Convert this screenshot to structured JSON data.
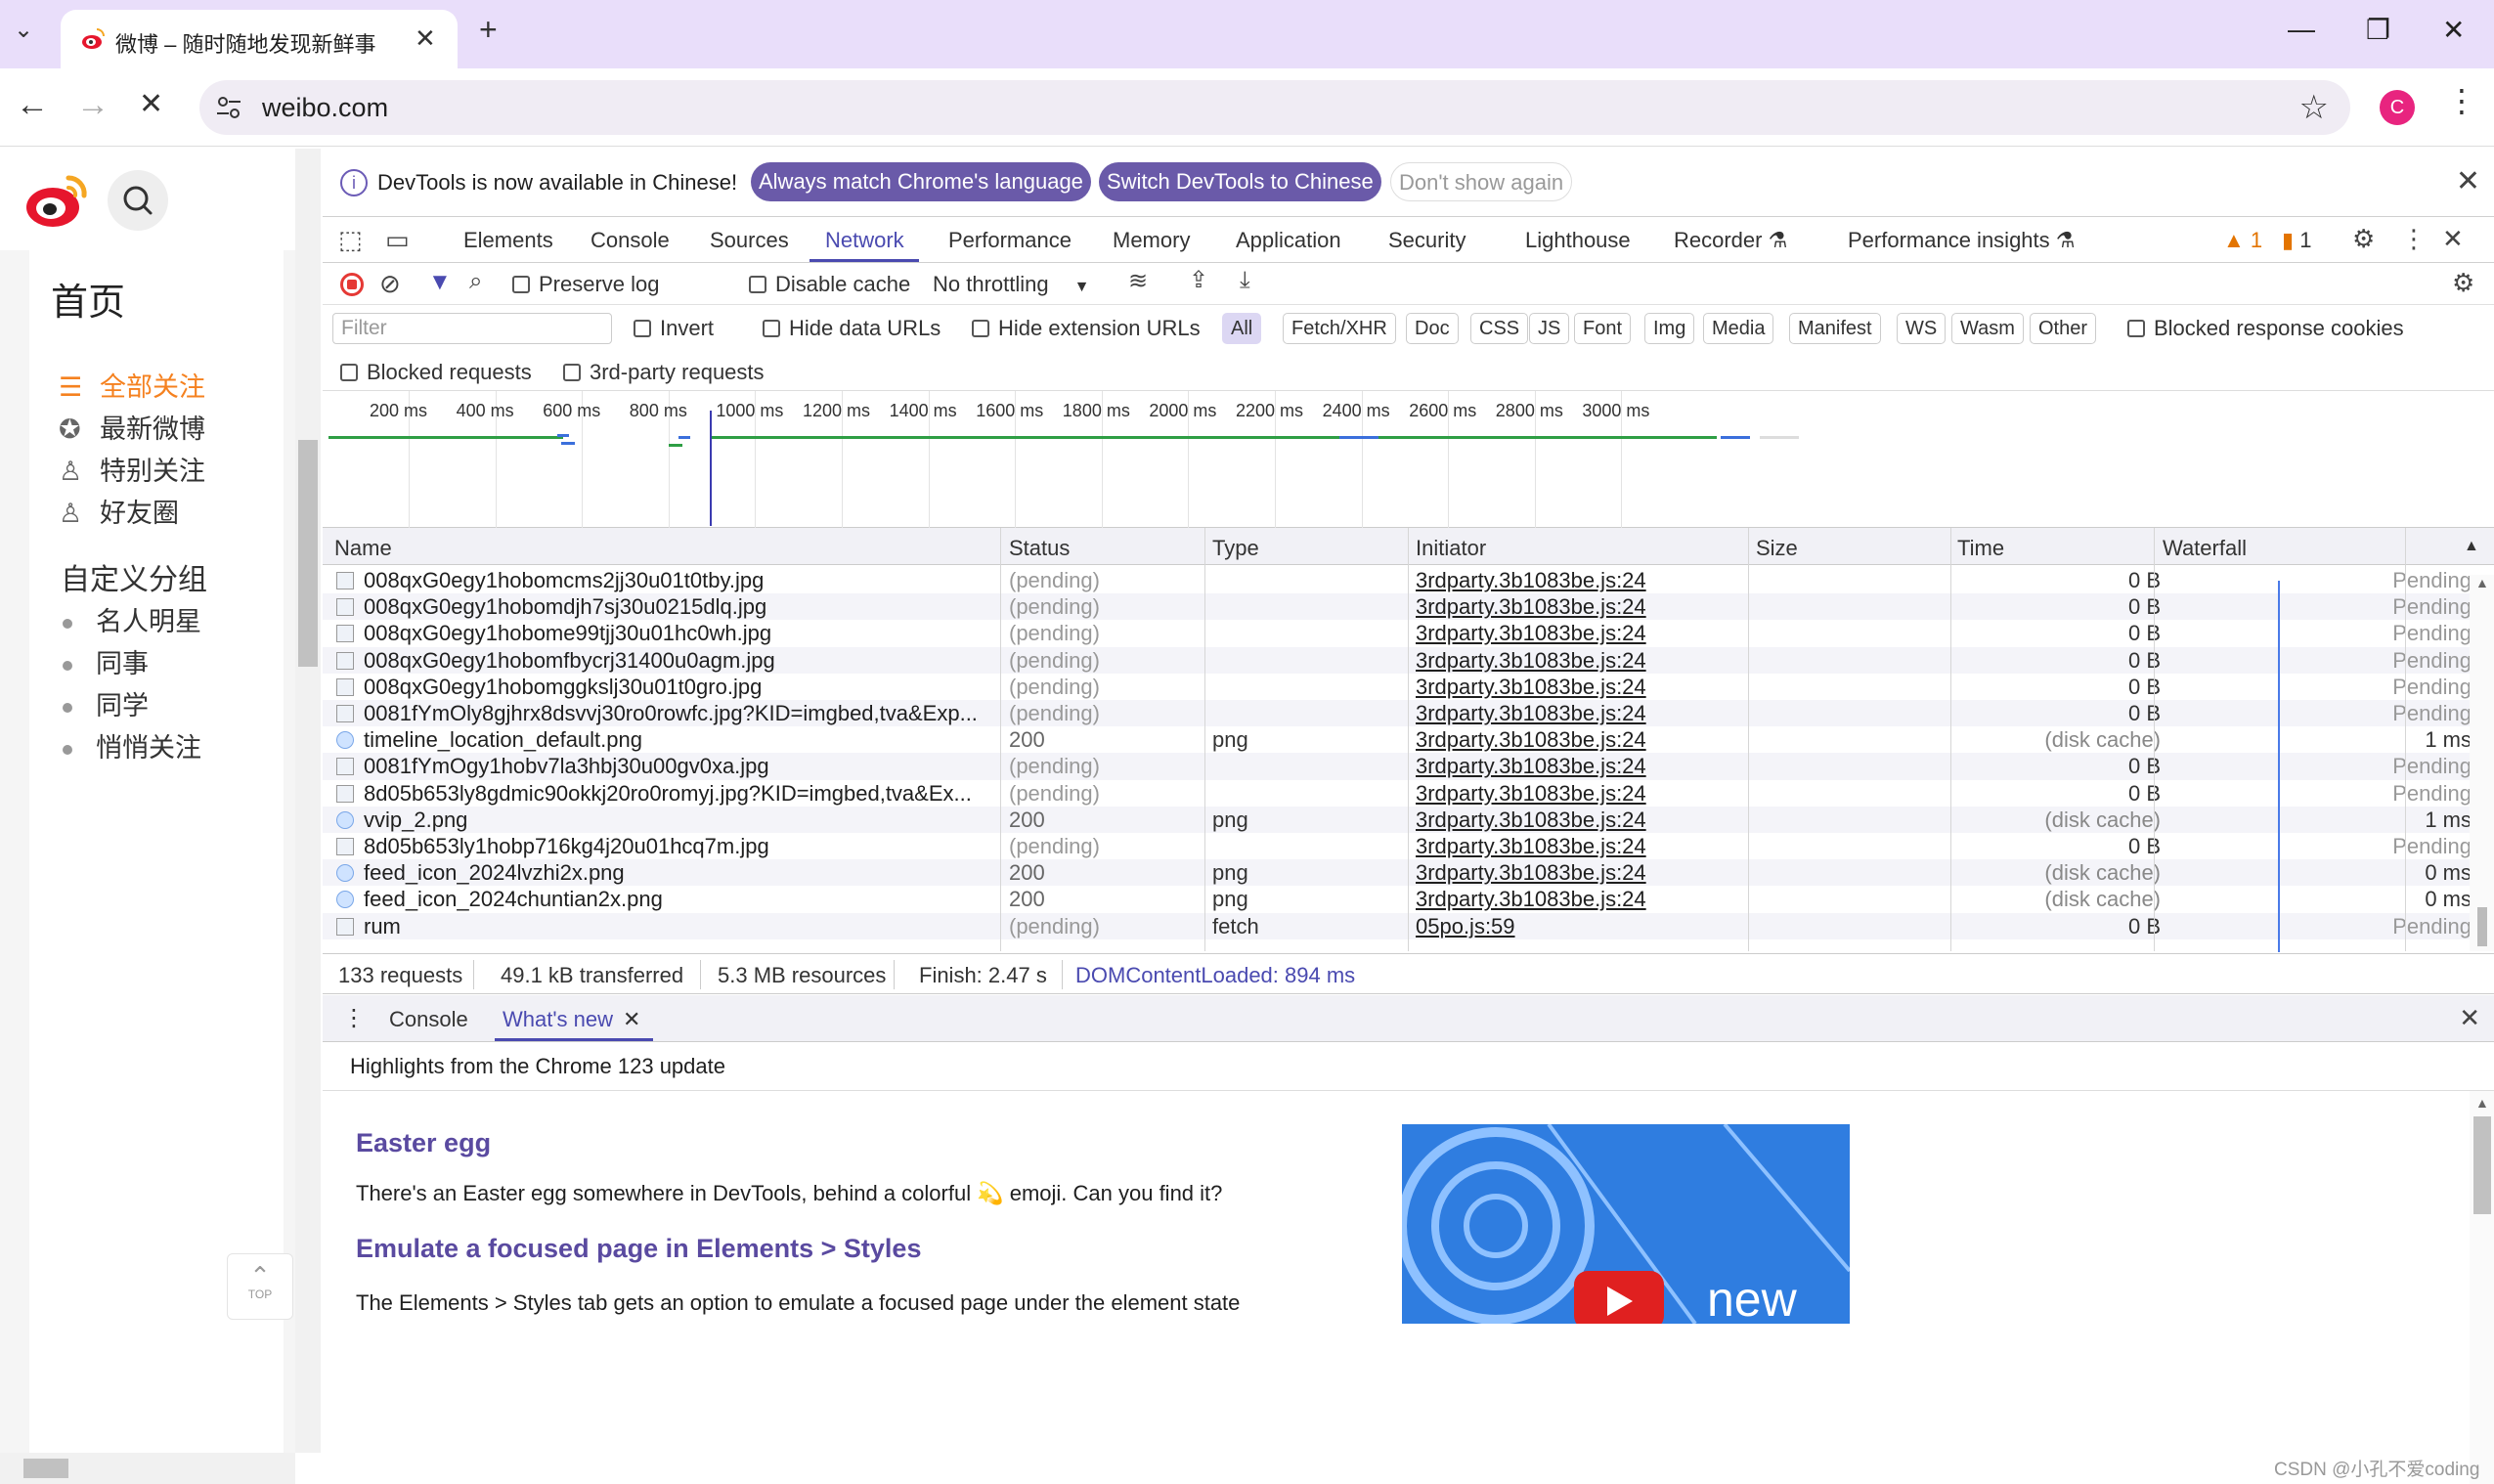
{
  "browser": {
    "tab_title": "微博 – 随时随地发现新鲜事",
    "url": "weibo.com",
    "profile_initial": "C"
  },
  "weibo": {
    "home_title": "首页",
    "nav": [
      {
        "label": "全部关注",
        "icon": "list-icon",
        "active": true
      },
      {
        "label": "最新微博",
        "icon": "star-circle-icon",
        "active": false
      },
      {
        "label": "特别关注",
        "icon": "user-star-icon",
        "active": false
      },
      {
        "label": "好友圈",
        "icon": "user-friend-icon",
        "active": false
      }
    ],
    "group_title": "自定义分组",
    "groups": [
      "名人明星",
      "同事",
      "同学",
      "悄悄关注"
    ],
    "top_label": "TOP"
  },
  "devtools": {
    "infobar": {
      "message": "DevTools is now available in Chinese!",
      "btn_match": "Always match Chrome's language",
      "btn_switch": "Switch DevTools to Chinese",
      "btn_dismiss": "Don't show again"
    },
    "tabs": [
      "Elements",
      "Console",
      "Sources",
      "Network",
      "Performance",
      "Memory",
      "Application",
      "Security",
      "Lighthouse",
      "Recorder ⚗",
      "Performance insights ⚗"
    ],
    "warnings_count": "1",
    "issues_count": "1",
    "toolbar": {
      "preserve_log": "Preserve log",
      "disable_cache": "Disable cache",
      "throttling": "No throttling"
    },
    "filter": {
      "placeholder": "Filter",
      "invert": "Invert",
      "hide_data": "Hide data URLs",
      "hide_ext": "Hide extension URLs",
      "types": [
        "All",
        "Fetch/XHR",
        "Doc",
        "CSS",
        "JS",
        "Font",
        "Img",
        "Media",
        "Manifest",
        "WS",
        "Wasm",
        "Other"
      ],
      "selected_type": "All",
      "blocked_cookies": "Blocked response cookies",
      "blocked_requests": "Blocked requests",
      "third_party": "3rd-party requests"
    },
    "timeline_ticks": [
      "200 ms",
      "400 ms",
      "600 ms",
      "800 ms",
      "1000 ms",
      "1200 ms",
      "1400 ms",
      "1600 ms",
      "1800 ms",
      "2000 ms",
      "2200 ms",
      "2400 ms",
      "2600 ms",
      "2800 ms",
      "3000 ms"
    ],
    "columns": [
      "Name",
      "Status",
      "Type",
      "Initiator",
      "Size",
      "Time",
      "Waterfall"
    ],
    "rows": [
      {
        "name": "008qxG0egy1hobomcms2jj30u01t0tby.jpg",
        "status": "(pending)",
        "type": "",
        "initiator": "3rdparty.3b1083be.js:24",
        "size": "0 B",
        "time": "Pending"
      },
      {
        "name": "008qxG0egy1hobomdjh7sj30u0215dlq.jpg",
        "status": "(pending)",
        "type": "",
        "initiator": "3rdparty.3b1083be.js:24",
        "size": "0 B",
        "time": "Pending"
      },
      {
        "name": "008qxG0egy1hobome99tjj30u01hc0wh.jpg",
        "status": "(pending)",
        "type": "",
        "initiator": "3rdparty.3b1083be.js:24",
        "size": "0 B",
        "time": "Pending"
      },
      {
        "name": "008qxG0egy1hobomfbycrj31400u0agm.jpg",
        "status": "(pending)",
        "type": "",
        "initiator": "3rdparty.3b1083be.js:24",
        "size": "0 B",
        "time": "Pending"
      },
      {
        "name": "008qxG0egy1hobomggkslj30u01t0gro.jpg",
        "status": "(pending)",
        "type": "",
        "initiator": "3rdparty.3b1083be.js:24",
        "size": "0 B",
        "time": "Pending"
      },
      {
        "name": "0081fYmOly8gjhrx8dsvvj30ro0rowfc.jpg?KID=imgbed,tva&Exp...",
        "status": "(pending)",
        "type": "",
        "initiator": "3rdparty.3b1083be.js:24",
        "size": "0 B",
        "time": "Pending"
      },
      {
        "name": "timeline_location_default.png",
        "status": "200",
        "type": "png",
        "initiator": "3rdparty.3b1083be.js:24",
        "size": "(disk cache)",
        "time": "1 ms"
      },
      {
        "name": "0081fYmOgy1hobv7la3hbj30u00gv0xa.jpg",
        "status": "(pending)",
        "type": "",
        "initiator": "3rdparty.3b1083be.js:24",
        "size": "0 B",
        "time": "Pending"
      },
      {
        "name": "8d05b653ly8gdmic90okkj20ro0romyj.jpg?KID=imgbed,tva&Ex...",
        "status": "(pending)",
        "type": "",
        "initiator": "3rdparty.3b1083be.js:24",
        "size": "0 B",
        "time": "Pending"
      },
      {
        "name": "vvip_2.png",
        "status": "200",
        "type": "png",
        "initiator": "3rdparty.3b1083be.js:24",
        "size": "(disk cache)",
        "time": "1 ms"
      },
      {
        "name": "8d05b653ly1hobp716kg4j20u01hcq7m.jpg",
        "status": "(pending)",
        "type": "",
        "initiator": "3rdparty.3b1083be.js:24",
        "size": "0 B",
        "time": "Pending"
      },
      {
        "name": "feed_icon_2024lvzhi2x.png",
        "status": "200",
        "type": "png",
        "initiator": "3rdparty.3b1083be.js:24",
        "size": "(disk cache)",
        "time": "0 ms"
      },
      {
        "name": "feed_icon_2024chuntian2x.png",
        "status": "200",
        "type": "png",
        "initiator": "3rdparty.3b1083be.js:24",
        "size": "(disk cache)",
        "time": "0 ms"
      },
      {
        "name": "rum",
        "status": "(pending)",
        "type": "fetch",
        "initiator": "05po.js:59",
        "size": "0 B",
        "time": "Pending"
      }
    ],
    "summary": {
      "requests": "133 requests",
      "transferred": "49.1 kB transferred",
      "resources": "5.3 MB resources",
      "finish": "Finish: 2.47 s",
      "dcl": "DOMContentLoaded: 894 ms"
    },
    "drawer": {
      "tab_console": "Console",
      "tab_whatsnew": "What's new",
      "highlights": "Highlights from the Chrome 123 update",
      "h1": "Easter egg",
      "p1": "There's an Easter egg somewhere in DevTools, behind a colorful 💫 emoji. Can you find it?",
      "h2": "Emulate a focused page in Elements > Styles",
      "p2": "The Elements > Styles tab gets an option to emulate a focused page under the element state",
      "promo_text": "new"
    }
  },
  "watermark": "CSDN @小孔不爱coding"
}
